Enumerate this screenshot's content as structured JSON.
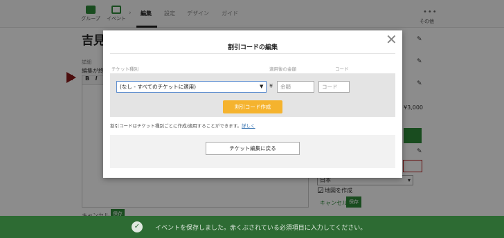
{
  "nav": {
    "group_label": "グループ",
    "event_label": "イベント",
    "arrow": "›",
    "tabs": [
      "編集",
      "設定",
      "デザイン",
      "ガイド"
    ],
    "more_dots": "•••",
    "more_label": "その他"
  },
  "page": {
    "title": "吉見",
    "detail_label": "詳細",
    "editor_note": "編集が終",
    "toolbar_bold": "B",
    "toolbar_italic": "I",
    "bottom_left_label": "キャンセル",
    "bottom_left_btn": "保存"
  },
  "sidebar": {
    "price": "¥3,000",
    "country": "日本",
    "map_checkbox": "地図を作成",
    "map_checked": true,
    "cancel_label": "キャンセル",
    "save_label": "保存"
  },
  "modal": {
    "title": "割引コードの編集",
    "close_glyph": "✕",
    "col_ticket": "チケット種別",
    "col_amount": "適用後の金額",
    "col_code": "コード",
    "ticket_select_value": "(なし - すべてのチケットに適用)",
    "yen_symbol": "¥",
    "amount_placeholder": "金額",
    "code_placeholder": "コード",
    "create_button": "割引コード作成",
    "help_text": "割引コードはチケット種別ごとに作成/適用することができます。",
    "help_link": "詳しく",
    "back_button": "チケット編集に戻る"
  },
  "notice": {
    "check_glyph": "✓",
    "text": "イベントを保存しました。赤くぶされている必須項目に入力してください。"
  },
  "colors": {
    "brand_green": "#2f8a3a",
    "notice_green": "#2d6b33",
    "create_button": "#f5b32e",
    "select_border": "#5b8ccf"
  }
}
